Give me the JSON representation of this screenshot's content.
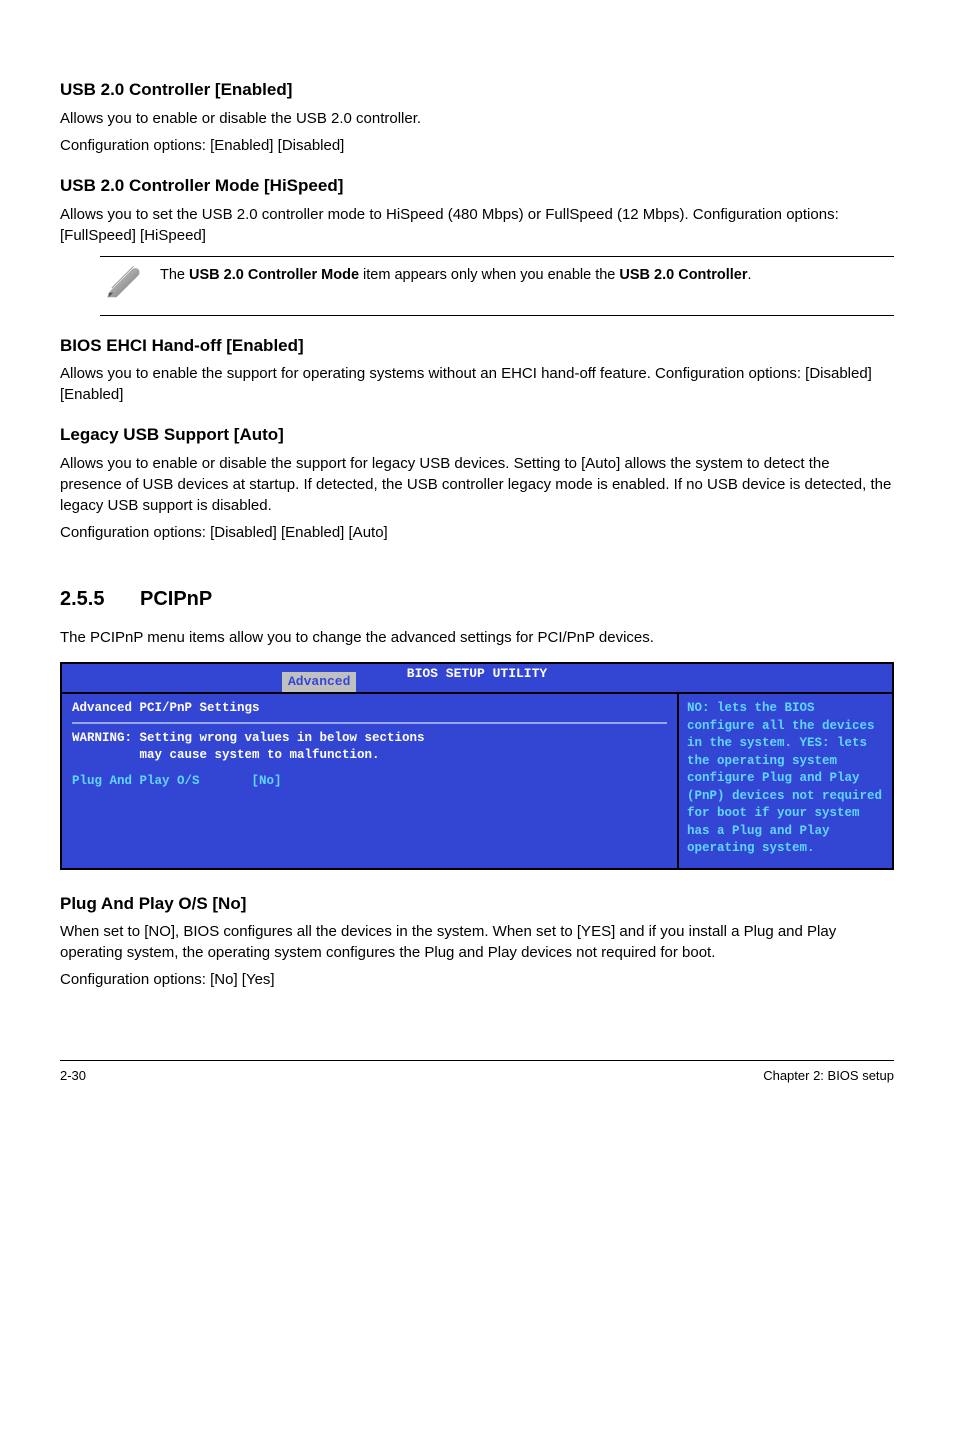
{
  "sections": {
    "usb20_ctrl": {
      "heading": "USB 2.0 Controller [Enabled]",
      "p1": "Allows you to enable or disable the USB 2.0 controller.",
      "p2": "Configuration options: [Enabled] [Disabled]"
    },
    "usb20_mode": {
      "heading": "USB 2.0 Controller Mode [HiSpeed]",
      "p1": "Allows you to set the USB 2.0 controller mode to HiSpeed (480 Mbps) or FullSpeed (12 Mbps). Configuration options: [FullSpeed] [HiSpeed]"
    },
    "note": {
      "prefix": "The ",
      "bold1": "USB 2.0 Controller Mode",
      "mid": " item appears only when you enable the ",
      "bold2": "USB 2.0 Controller",
      "suffix": "."
    },
    "ehci": {
      "heading": "BIOS EHCI Hand-off [Enabled]",
      "p1": "Allows you to enable the support for operating systems without an EHCI hand-off feature. Configuration options: [Disabled] [Enabled]"
    },
    "legacy": {
      "heading": "Legacy USB Support [Auto]",
      "p1": "Allows you to enable or disable the support for legacy USB devices. Setting to [Auto] allows the system to detect the presence of USB devices at startup. If detected, the USB controller legacy mode is enabled. If no USB device is detected, the legacy USB support is disabled.",
      "p2": "Configuration options: [Disabled] [Enabled] [Auto]"
    },
    "pcipnp": {
      "num": "2.5.5",
      "title": "PCIPnP",
      "intro": "The PCIPnP menu items allow you to change the advanced settings for PCI/PnP devices."
    },
    "bios": {
      "title": "BIOS SETUP UTILITY",
      "tab": "Advanced",
      "left_heading": "Advanced PCI/PnP Settings",
      "warning_l1": "WARNING: Setting wrong values in below sections",
      "warning_l2": "         may cause system to malfunction.",
      "option_label": "Plug And Play O/S",
      "option_value": "[No]",
      "help": "NO: lets the BIOS configure all the devices in the system. YES: lets the operating system configure Plug and Play (PnP) devices not required for boot if your system has a Plug and Play operating system."
    },
    "plugplay": {
      "heading": "Plug And Play O/S [No]",
      "p1": "When set to [NO], BIOS configures all the devices in the system. When set to [YES] and if you install a Plug and Play operating system, the operating system configures the Plug and Play devices not required for boot.",
      "p2": "Configuration options: [No] [Yes]"
    }
  },
  "footer": {
    "left": "2-30",
    "right": "Chapter 2: BIOS setup"
  }
}
